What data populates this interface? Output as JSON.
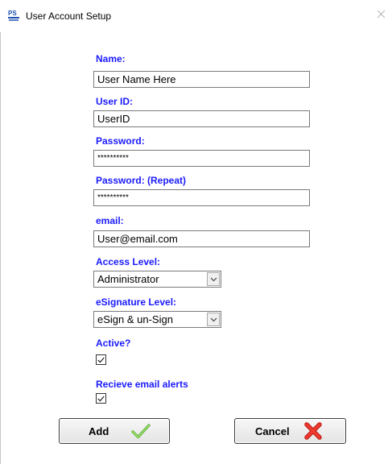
{
  "window": {
    "title": "User Account Setup",
    "app_icon_text": "PS"
  },
  "form": {
    "name": {
      "label": "Name:",
      "value": "User Name Here"
    },
    "user_id": {
      "label": "User ID:",
      "value": "UserID"
    },
    "password": {
      "label": "Password:",
      "value": "**********"
    },
    "password_repeat": {
      "label": "Password: (Repeat)",
      "value": "**********"
    },
    "email": {
      "label": "email:",
      "value": "User@email.com"
    },
    "access_level": {
      "label": "Access Level:",
      "value": "Administrator"
    },
    "esignature_level": {
      "label": "eSignature Level:",
      "value": "eSign & un-Sign"
    },
    "active": {
      "label": "Active?",
      "checked": true
    },
    "email_alerts": {
      "label": "Recieve email alerts",
      "checked": true
    }
  },
  "buttons": {
    "add_label": "Add",
    "cancel_label": "Cancel"
  },
  "colors": {
    "label_blue": "#1a1aff",
    "check_green": "#7dd34a",
    "cancel_red": "#e8231f"
  }
}
